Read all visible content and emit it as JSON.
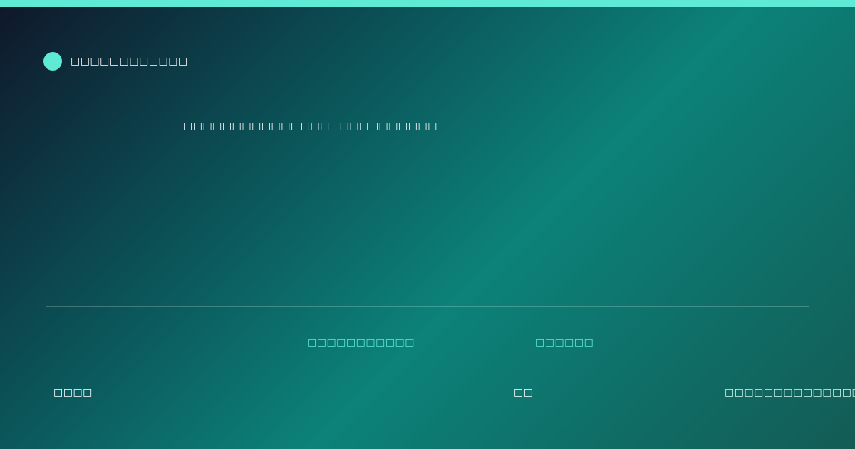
{
  "brand": {
    "name": "□□□□□□□□□□□□"
  },
  "headline": "□□□□□□□□□□□□□□□□□□□□□□□□□□",
  "labels": [
    "□□□□□□□□□□□",
    "□□□□□□"
  ],
  "footer": {
    "left": "□□□□",
    "middle": "□□",
    "right": "□□□□□□□□□□□□□□□□"
  },
  "colors": {
    "accent": "#5eead4",
    "background_start": "#0f172a",
    "background_mid": "#0c8279",
    "background_end": "#135c55"
  }
}
